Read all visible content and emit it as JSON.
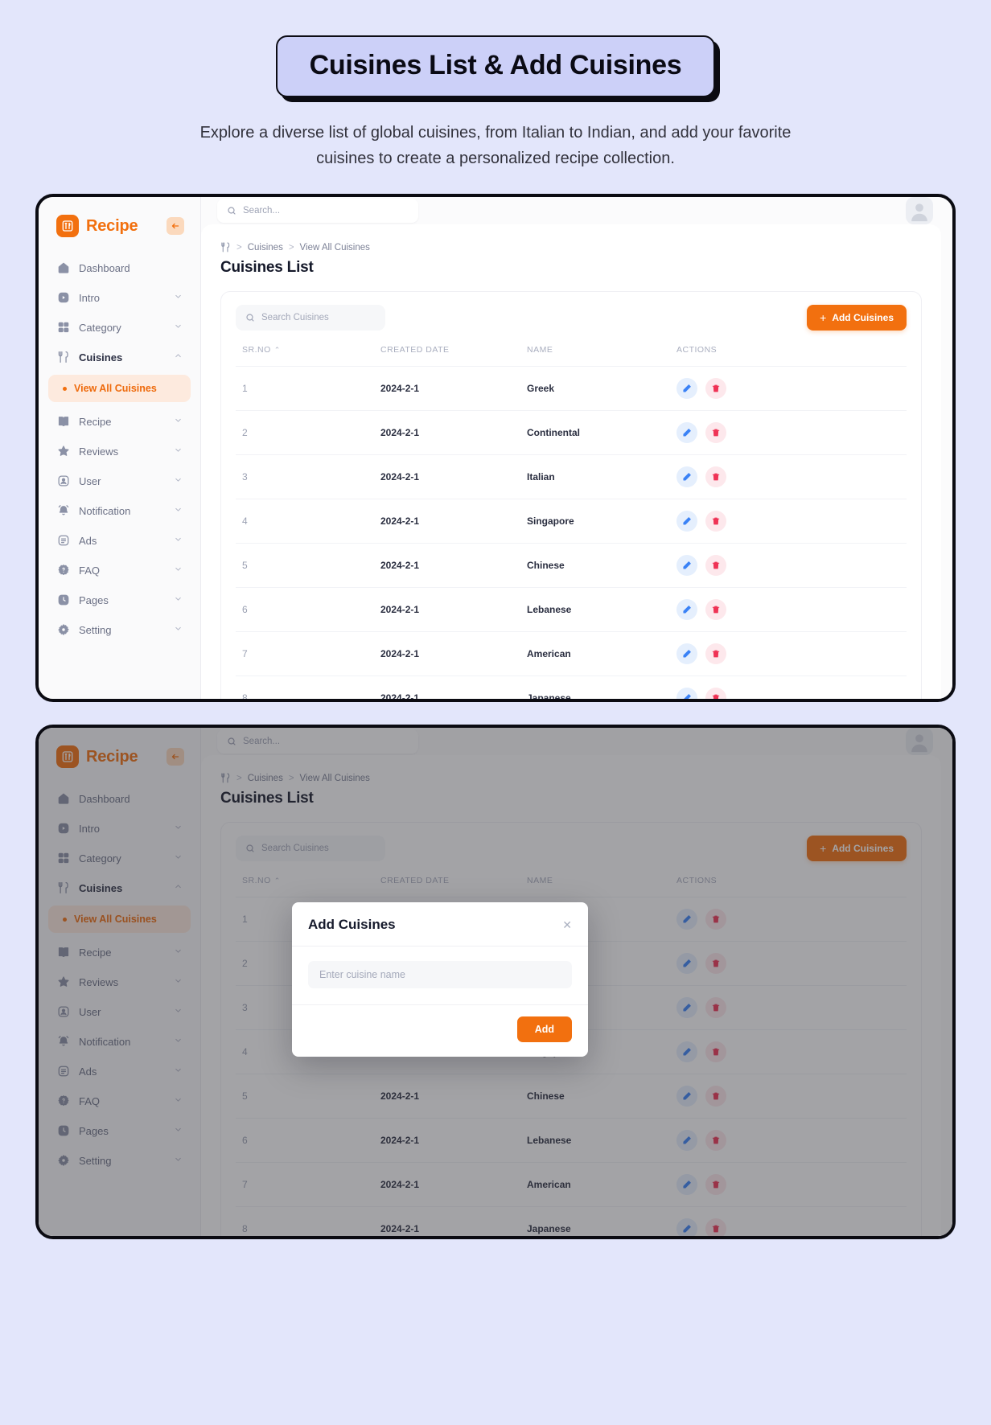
{
  "hero": {
    "title": "Cuisines List & Add Cuisines",
    "subtitle": "Explore a diverse list of global cuisines, from Italian to Indian, and add your favorite cuisines to create a personalized recipe collection."
  },
  "colors": {
    "accent": "#f2700f",
    "page_bg": "#e3e6fb",
    "title_box_bg": "#ccd0f8",
    "edit_icon": "#3b82f6",
    "delete_icon": "#ef3355"
  },
  "app": {
    "brand": "Recipe",
    "topbar": {
      "search_placeholder": "Search..."
    },
    "sidebar": {
      "items": [
        {
          "label": "Dashboard",
          "icon": "home-icon",
          "expandable": false
        },
        {
          "label": "Intro",
          "icon": "intro-icon",
          "expandable": true
        },
        {
          "label": "Category",
          "icon": "category-icon",
          "expandable": true
        },
        {
          "label": "Cuisines",
          "icon": "cuisines-icon",
          "expandable": true,
          "expanded": true,
          "active": true
        },
        {
          "label": "Recipe",
          "icon": "book-icon",
          "expandable": true
        },
        {
          "label": "Reviews",
          "icon": "star-icon",
          "expandable": true
        },
        {
          "label": "User",
          "icon": "user-icon",
          "expandable": true
        },
        {
          "label": "Notification",
          "icon": "bell-icon",
          "expandable": true
        },
        {
          "label": "Ads",
          "icon": "ads-icon",
          "expandable": true
        },
        {
          "label": "FAQ",
          "icon": "faq-icon",
          "expandable": true
        },
        {
          "label": "Pages",
          "icon": "pages-icon",
          "expandable": true
        },
        {
          "label": "Setting",
          "icon": "gear-icon",
          "expandable": true
        }
      ],
      "sub_item": {
        "label": "View All Cuisines",
        "active": true
      }
    },
    "breadcrumb": {
      "icon": "cuisines-icon",
      "items": [
        "Cuisines",
        "View All Cuisines"
      ],
      "separator": ">"
    },
    "page_title": "Cuisines List",
    "toolbar": {
      "search_placeholder": "Search Cuisines",
      "add_button_label": "Add Cuisines",
      "add_button_plus": "+"
    },
    "table": {
      "columns": [
        "SR.NO",
        "CREATED DATE",
        "NAME",
        "ACTIONS"
      ],
      "sort_column": "SR.NO",
      "sort_caret": "⌃",
      "rows": [
        {
          "sr": "1",
          "created": "2024-2-1",
          "name": "Greek"
        },
        {
          "sr": "2",
          "created": "2024-2-1",
          "name": "Continental"
        },
        {
          "sr": "3",
          "created": "2024-2-1",
          "name": "Italian"
        },
        {
          "sr": "4",
          "created": "2024-2-1",
          "name": "Singapore"
        },
        {
          "sr": "5",
          "created": "2024-2-1",
          "name": "Chinese"
        },
        {
          "sr": "6",
          "created": "2024-2-1",
          "name": "Lebanese"
        },
        {
          "sr": "7",
          "created": "2024-2-1",
          "name": "American"
        },
        {
          "sr": "8",
          "created": "2024-2-1",
          "name": "Japanese"
        }
      ]
    },
    "modal": {
      "title": "Add Cuisines",
      "close": "✕",
      "input_placeholder": "Enter cuisine name",
      "input_value": "",
      "submit_label": "Add"
    }
  }
}
